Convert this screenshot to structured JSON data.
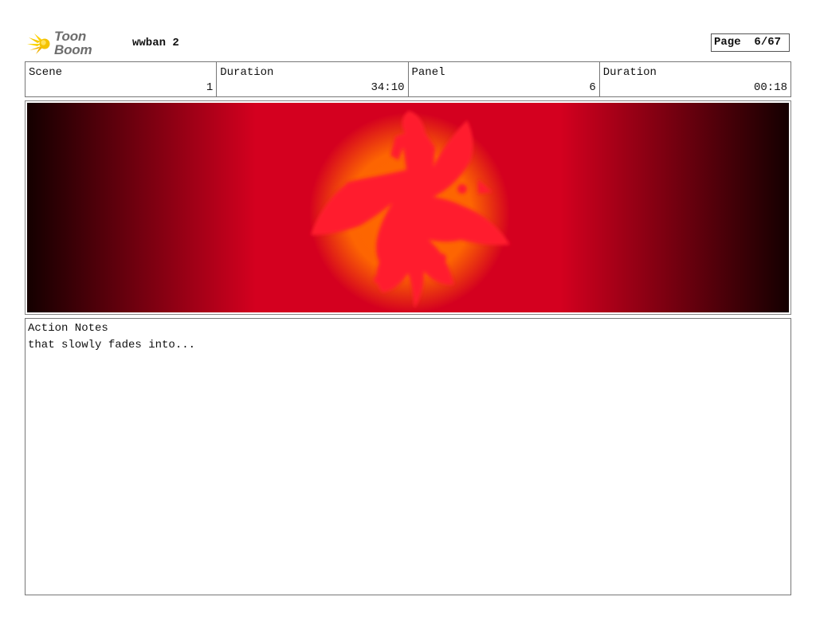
{
  "header": {
    "logo_text": "Toon Boom",
    "project_title": "wwban 2",
    "page_label": "Page",
    "page_value": "6/67"
  },
  "info": {
    "scene_label": "Scene",
    "scene_value": "1",
    "scene_duration_label": "Duration",
    "scene_duration_value": "34:10",
    "panel_label": "Panel",
    "panel_value": "6",
    "panel_duration_label": "Duration",
    "panel_duration_value": "00:18"
  },
  "panel": {
    "background_color": "#d4001f",
    "glow_color": "#ff6a00",
    "edge_color": "#140000",
    "figure_color": "#ff1f2f"
  },
  "notes": {
    "label": "Action Notes",
    "text": "that slowly fades into..."
  }
}
